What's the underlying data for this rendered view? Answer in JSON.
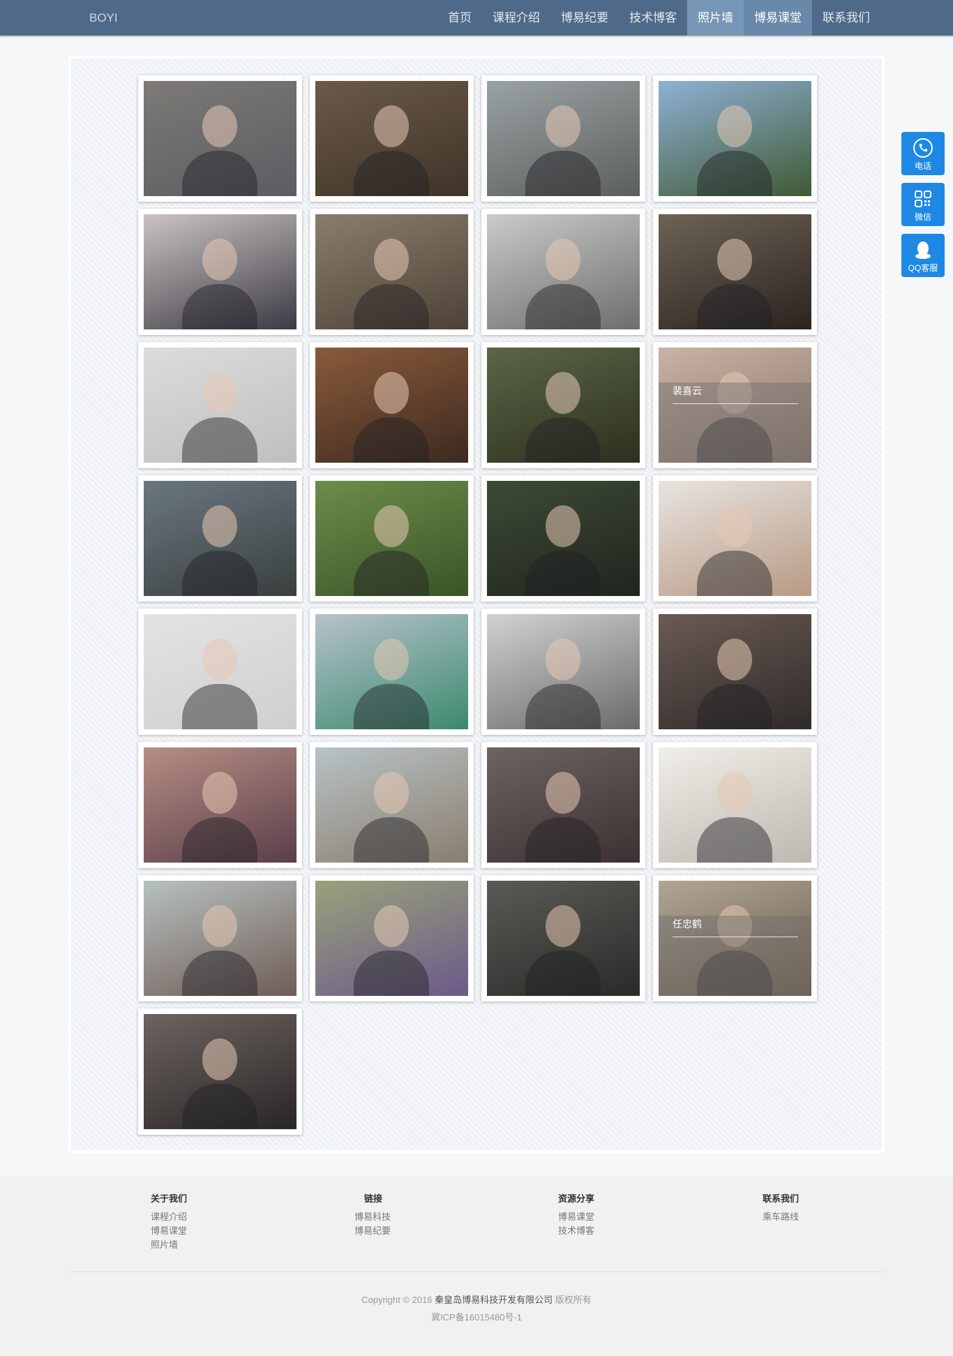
{
  "nav": {
    "brand": "BOYI",
    "items": [
      "首页",
      "课程介绍",
      "博易纪要",
      "技术博客",
      "照片墙",
      "博易课堂",
      "联系我们"
    ]
  },
  "gallery": {
    "photos": [
      {
        "scene": "colors",
        "c1": "#7d7a76",
        "c2": "#5a5d62"
      },
      {
        "scene": "colors",
        "c1": "#6b5a49",
        "c2": "#3f3328"
      },
      {
        "scene": "colors",
        "c1": "#9ba2a4",
        "c2": "#5b5f5c"
      },
      {
        "scene": "colors",
        "c1": "#8fb1d6",
        "c2": "#3f5a33"
      },
      {
        "scene": "colors",
        "c1": "#c9c4c2",
        "c2": "#3d3a44"
      },
      {
        "scene": "colors",
        "c1": "#8b7d6c",
        "c2": "#4d4238"
      },
      {
        "scene": "colors",
        "c1": "#c9cbc7",
        "c2": "#6e6e6c"
      },
      {
        "scene": "colors",
        "c1": "#6e6255",
        "c2": "#2a2420"
      },
      {
        "scene": "colors",
        "c1": "#dcdcdc",
        "c2": "#bfbfbf"
      },
      {
        "scene": "colors",
        "c1": "#8a5a3a",
        "c2": "#3c2a20"
      },
      {
        "scene": "colors",
        "c1": "#5a6646",
        "c2": "#2c301f"
      },
      {
        "scene": "colors",
        "c1": "#c8b3a6",
        "c2": "#8b7468",
        "caption": "裴喜云"
      },
      {
        "scene": "colors",
        "c1": "#6a7780",
        "c2": "#3a3f3e"
      },
      {
        "scene": "colors",
        "c1": "#6e8c4a",
        "c2": "#3a5427"
      },
      {
        "scene": "colors",
        "c1": "#3e4a34",
        "c2": "#1f2520"
      },
      {
        "scene": "colors",
        "c1": "#e8e4e0",
        "c2": "#b89a85"
      },
      {
        "scene": "colors",
        "c1": "#e3e3e3",
        "c2": "#cfcfcf"
      },
      {
        "scene": "colors",
        "c1": "#b7c2cb",
        "c2": "#3b8a6e"
      },
      {
        "scene": "colors",
        "c1": "#cfd2d4",
        "c2": "#6c6a68"
      },
      {
        "scene": "colors",
        "c1": "#6b5a54",
        "c2": "#2f2b2a"
      },
      {
        "scene": "colors",
        "c1": "#b68e84",
        "c2": "#5a3e4a"
      },
      {
        "scene": "colors",
        "c1": "#b8c2c6",
        "c2": "#8a7e6e"
      },
      {
        "scene": "colors",
        "c1": "#6e6262",
        "c2": "#3d3030"
      },
      {
        "scene": "colors",
        "c1": "#f0eee9",
        "c2": "#bdb8b0"
      },
      {
        "scene": "colors",
        "c1": "#b7c1be",
        "c2": "#6f5c58"
      },
      {
        "scene": "colors",
        "c1": "#9aa27a",
        "c2": "#6a5a8a"
      },
      {
        "scene": "colors",
        "c1": "#5a5a56",
        "c2": "#2a2a28"
      },
      {
        "scene": "colors",
        "c1": "#b0a694",
        "c2": "#6c5a48",
        "caption": "任忠鹤"
      },
      {
        "scene": "colors",
        "c1": "#6c6460",
        "c2": "#2a2626"
      }
    ]
  },
  "side": {
    "phone": "电话",
    "wechat": "微信",
    "qq": "QQ客服",
    "color": "#1e88e5"
  },
  "footer": {
    "col1": {
      "title": "关于我们",
      "links": [
        "课程介绍",
        "博易课堂",
        "照片墙"
      ]
    },
    "col2": {
      "title": "链接",
      "links": [
        "博易科技",
        "博易纪要"
      ]
    },
    "col3": {
      "title": "资源分享",
      "links": [
        "博易课堂",
        "技术博客"
      ]
    },
    "col4": {
      "title": "联系我们",
      "links": [
        "乘车路线"
      ]
    },
    "copyright_prefix": "Copyright © 2016",
    "company": "秦皇岛博易科技开发有限公司",
    "rights": "版权所有",
    "icp": "冀ICP备16015480号-1"
  }
}
